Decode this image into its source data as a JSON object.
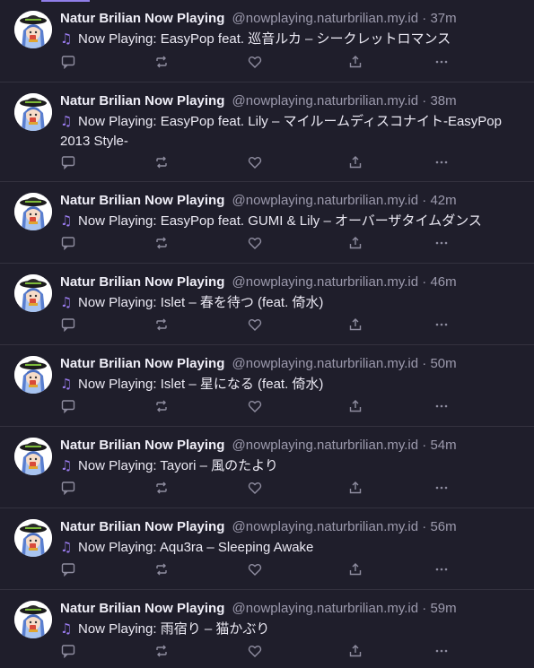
{
  "feed": {
    "posts": [
      {
        "author": "Natur Brilian Now Playing",
        "handle": "@nowplaying.naturbrilian.my.id",
        "separator": "·",
        "time": "37m",
        "text": "Now Playing: EasyPop feat. 巡音ルカ – シークレットロマンス"
      },
      {
        "author": "Natur Brilian Now Playing",
        "handle": "@nowplaying.naturbrilian.my.id",
        "separator": "·",
        "time": "38m",
        "text": "Now Playing: EasyPop feat. Lily – マイルームディスコナイト-EasyPop 2013 Style-"
      },
      {
        "author": "Natur Brilian Now Playing",
        "handle": "@nowplaying.naturbrilian.my.id",
        "separator": "·",
        "time": "42m",
        "text": "Now Playing: EasyPop feat. GUMI & Lily – オーバーザタイムダンス"
      },
      {
        "author": "Natur Brilian Now Playing",
        "handle": "@nowplaying.naturbrilian.my.id",
        "separator": "·",
        "time": "46m",
        "text": "Now Playing: Islet – 春を待つ (feat. 倚水)"
      },
      {
        "author": "Natur Brilian Now Playing",
        "handle": "@nowplaying.naturbrilian.my.id",
        "separator": "·",
        "time": "50m",
        "text": "Now Playing: Islet – 星になる (feat. 倚水)"
      },
      {
        "author": "Natur Brilian Now Playing",
        "handle": "@nowplaying.naturbrilian.my.id",
        "separator": "·",
        "time": "54m",
        "text": "Now Playing: Tayori – 風のたより"
      },
      {
        "author": "Natur Brilian Now Playing",
        "handle": "@nowplaying.naturbrilian.my.id",
        "separator": "·",
        "time": "56m",
        "text": "Now Playing: Aqu3ra – Sleeping Awake"
      },
      {
        "author": "Natur Brilian Now Playing",
        "handle": "@nowplaying.naturbrilian.my.id",
        "separator": "·",
        "time": "59m",
        "text": "Now Playing: 雨宿り – 猫かぶり"
      }
    ],
    "note_icon": "♫",
    "actions": [
      "reply-icon",
      "repost-icon",
      "like-icon",
      "share-icon",
      "more-icon"
    ]
  },
  "colors": {
    "background": "#1f1e2b",
    "divider": "#34323f",
    "accent": "#9b7cf0",
    "muted": "#9c9aad"
  }
}
